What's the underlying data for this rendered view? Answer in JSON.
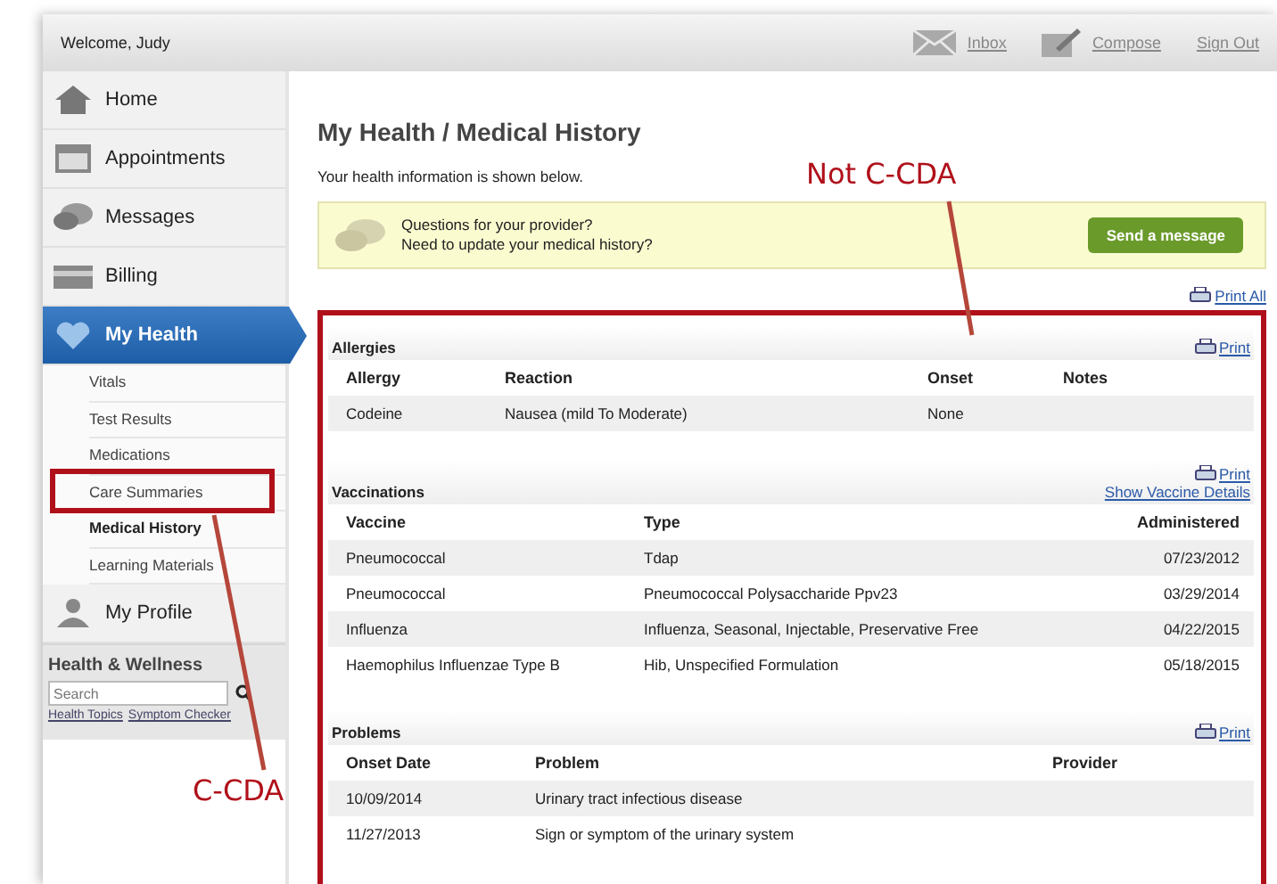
{
  "header": {
    "welcome": "Welcome, Judy",
    "links": [
      {
        "kind": "inbox",
        "label": "Inbox"
      },
      {
        "kind": "compose",
        "label": "Compose"
      },
      {
        "kind": "signout",
        "label": "Sign Out"
      }
    ]
  },
  "sidebar": {
    "items": [
      {
        "kind": "home",
        "label": "Home",
        "selected": false
      },
      {
        "kind": "calendar",
        "label": "Appointments",
        "selected": false
      },
      {
        "kind": "chat",
        "label": "Messages",
        "selected": false
      },
      {
        "kind": "card",
        "label": "Billing",
        "selected": false
      },
      {
        "kind": "heart",
        "label": "My Health",
        "selected": true,
        "children": [
          {
            "label": "Vitals",
            "selected": false
          },
          {
            "label": "Test Results",
            "selected": false
          },
          {
            "label": "Medications",
            "selected": false
          },
          {
            "label": "Care Summaries",
            "selected": false
          },
          {
            "label": "Medical History",
            "selected": true
          },
          {
            "label": "Learning Materials",
            "selected": false
          }
        ]
      },
      {
        "kind": "person",
        "label": "My Profile",
        "selected": false
      }
    ],
    "wellness": {
      "title": "Health & Wellness",
      "placeholder": "Search",
      "links": [
        "Health Topics",
        "Symptom Checker"
      ]
    }
  },
  "main": {
    "title": "My Health / Medical History",
    "subtitle": "Your health information is shown below.",
    "notice": {
      "lines": [
        "Questions for your provider?",
        "Need to update your medical history?"
      ],
      "button": "Send a message"
    },
    "print_all": "Print All",
    "sections": [
      {
        "title": "Allergies",
        "links": [
          "Print"
        ],
        "columns": [
          "Allergy",
          "Reaction",
          "Onset",
          "Notes"
        ],
        "rows": [
          [
            "Codeine",
            "Nausea (mild To Moderate)",
            "None",
            ""
          ]
        ]
      },
      {
        "title": "Vaccinations",
        "links": [
          "Print",
          "Show Vaccine Details"
        ],
        "columns": [
          "Vaccine",
          "Type",
          "Administered"
        ],
        "rows": [
          [
            "Pneumococcal",
            "Tdap",
            "07/23/2012"
          ],
          [
            "Pneumococcal",
            "Pneumococcal Polysaccharide Ppv23",
            "03/29/2014"
          ],
          [
            "Influenza",
            "Influenza, Seasonal, Injectable, Preservative Free",
            "04/22/2015"
          ],
          [
            "Haemophilus Influenzae Type B",
            "Hib, Unspecified Formulation",
            "05/18/2015"
          ]
        ]
      },
      {
        "title": "Problems",
        "links": [
          "Print"
        ],
        "columns": [
          "Onset Date",
          "Problem",
          "Provider"
        ],
        "rows": [
          [
            "10/09/2014",
            "Urinary tract infectious disease",
            ""
          ],
          [
            "11/27/2013",
            "Sign or symptom of the urinary system",
            ""
          ]
        ]
      }
    ]
  },
  "annotations": [
    {
      "kind": "content",
      "label": "Not C-CDA"
    },
    {
      "kind": "care",
      "label": "C-CDA"
    }
  ]
}
